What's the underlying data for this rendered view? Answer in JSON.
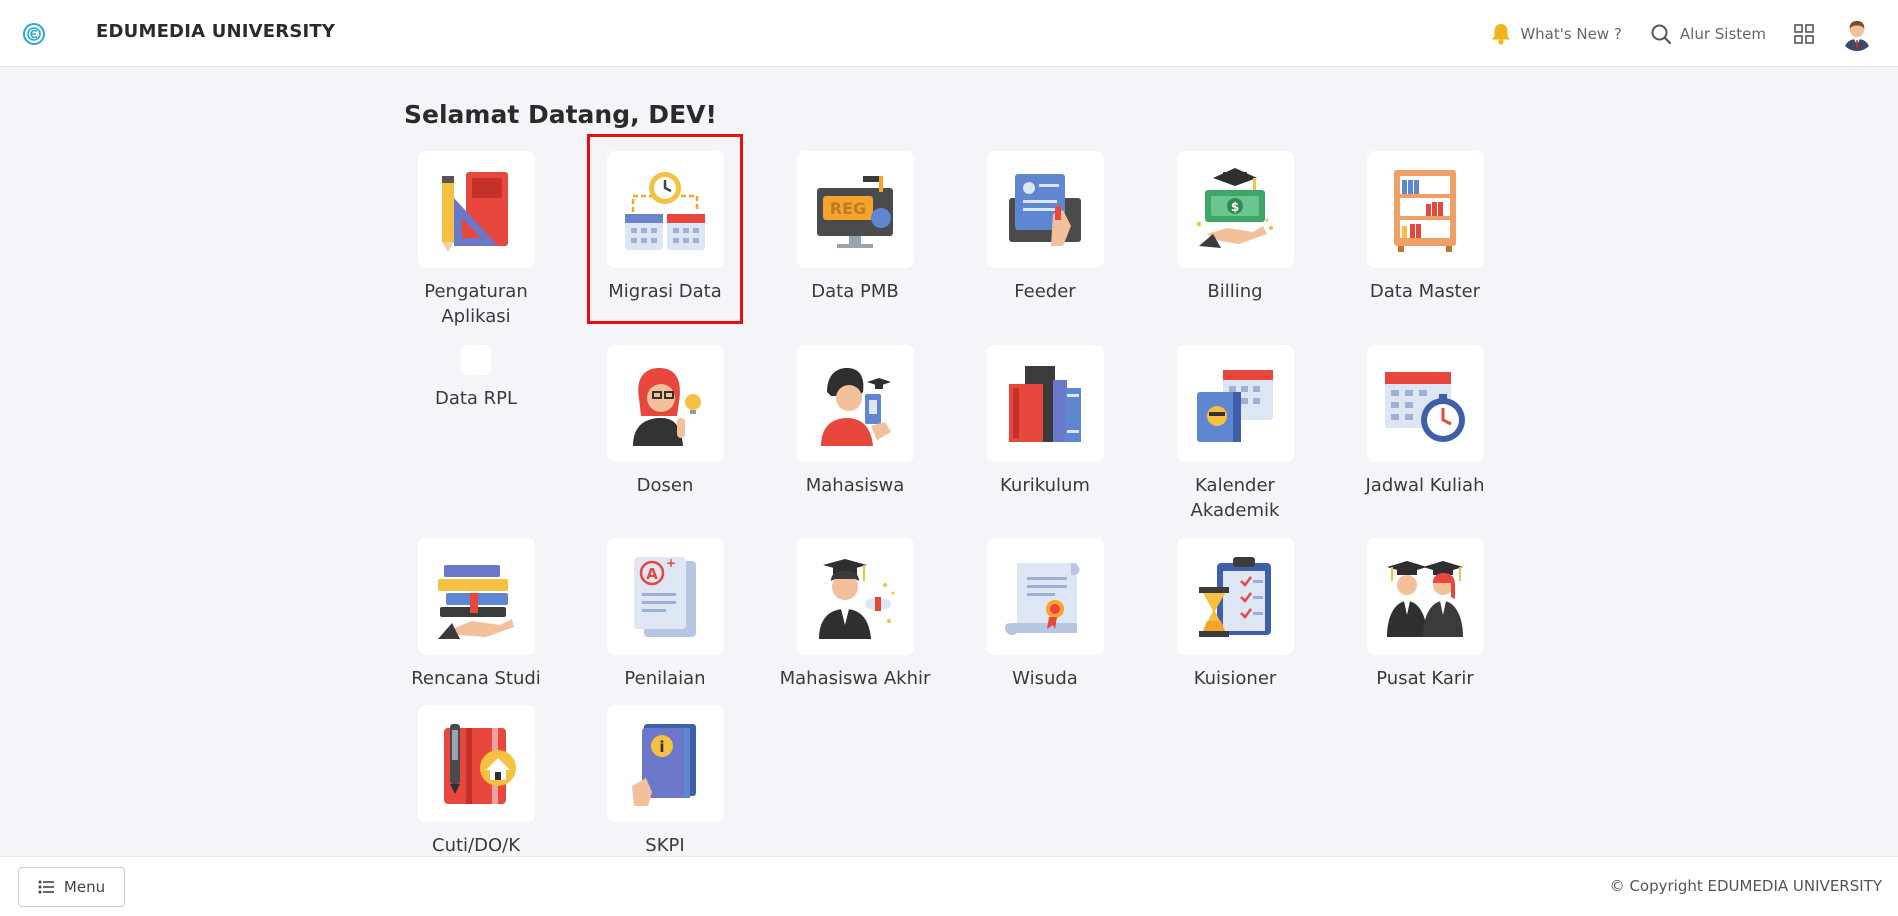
{
  "header": {
    "brand": "EDUMEDIA UNIVERSITY",
    "whats_new": "What's New ?",
    "alur_sistem": "Alur Sistem"
  },
  "main": {
    "welcome": "Selamat Datang, DEV!",
    "tiles": [
      {
        "label": "Pengaturan Aplikasi",
        "icon": "ruler-pencil-icon"
      },
      {
        "label": "Migrasi Data",
        "icon": "clock-calendar-icon"
      },
      {
        "label": "Data PMB",
        "icon": "reg-monitor-icon"
      },
      {
        "label": "Feeder",
        "icon": "document-upload-icon"
      },
      {
        "label": "Billing",
        "icon": "money-hand-icon"
      },
      {
        "label": "Data Master",
        "icon": "bookshelf-icon"
      },
      {
        "label": "Data RPL",
        "icon": "blank-icon"
      },
      {
        "label": "Dosen",
        "icon": "lecturer-icon"
      },
      {
        "label": "Mahasiswa",
        "icon": "student-icon"
      },
      {
        "label": "Kurikulum",
        "icon": "books-icon"
      },
      {
        "label": "Kalender Akademik",
        "icon": "calendar-book-icon"
      },
      {
        "label": "Jadwal Kuliah",
        "icon": "calendar-clock-icon"
      },
      {
        "label": "Rencana Studi",
        "icon": "book-stack-hand-icon"
      },
      {
        "label": "Penilaian",
        "icon": "graded-paper-icon"
      },
      {
        "label": "Mahasiswa Akhir",
        "icon": "graduate-diploma-icon"
      },
      {
        "label": "Wisuda",
        "icon": "certificate-scroll-icon"
      },
      {
        "label": "Kuisioner",
        "icon": "clipboard-hourglass-icon"
      },
      {
        "label": "Pusat Karir",
        "icon": "graduates-icon"
      },
      {
        "label": "Cuti/DO/K",
        "icon": "notebook-home-icon"
      },
      {
        "label": "SKPI",
        "icon": "info-book-icon"
      }
    ]
  },
  "footer": {
    "menu_label": "Menu",
    "copyright": "© Copyright EDUMEDIA UNIVERSITY"
  }
}
